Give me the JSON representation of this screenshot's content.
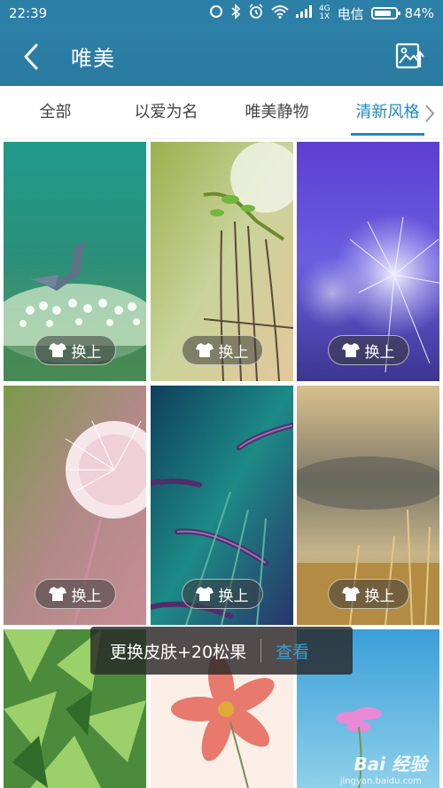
{
  "status_bar": {
    "time": "22:39",
    "network_top": "4G",
    "network_bottom": "1X",
    "carrier": "电信",
    "battery_percent_text": "84%",
    "battery_level": 0.84,
    "icons": [
      "sync-icon",
      "bluetooth-icon",
      "alarm-icon",
      "wifi-icon",
      "signal-icon",
      "battery-icon"
    ]
  },
  "header": {
    "title": "唯美",
    "back_icon": "chevron-left-icon",
    "action_icon": "image-upload-icon"
  },
  "tabs": [
    {
      "label": "全部",
      "active": false
    },
    {
      "label": "以爱为名",
      "active": false
    },
    {
      "label": "唯美静物",
      "active": false
    },
    {
      "label": "清新风格",
      "active": true
    }
  ],
  "apply_label": "换上",
  "wallpapers": [
    {
      "name": "butterfly-on-flowers"
    },
    {
      "name": "barbed-wire-fence"
    },
    {
      "name": "purple-dandelion"
    },
    {
      "name": "pink-dandelion"
    },
    {
      "name": "foxtail-grass"
    },
    {
      "name": "wheat-sunset"
    },
    {
      "name": "green-succulent"
    },
    {
      "name": "pink-cosmos-flower"
    },
    {
      "name": "pink-flower-sky"
    }
  ],
  "toast": {
    "message": "更换皮肤+20松果",
    "action": "查看"
  },
  "watermark": {
    "logo": "Bai 经验",
    "url": "jingyan.baidu.com"
  },
  "colors": {
    "header": "#2c7fa6",
    "accent": "#1d89bf"
  }
}
